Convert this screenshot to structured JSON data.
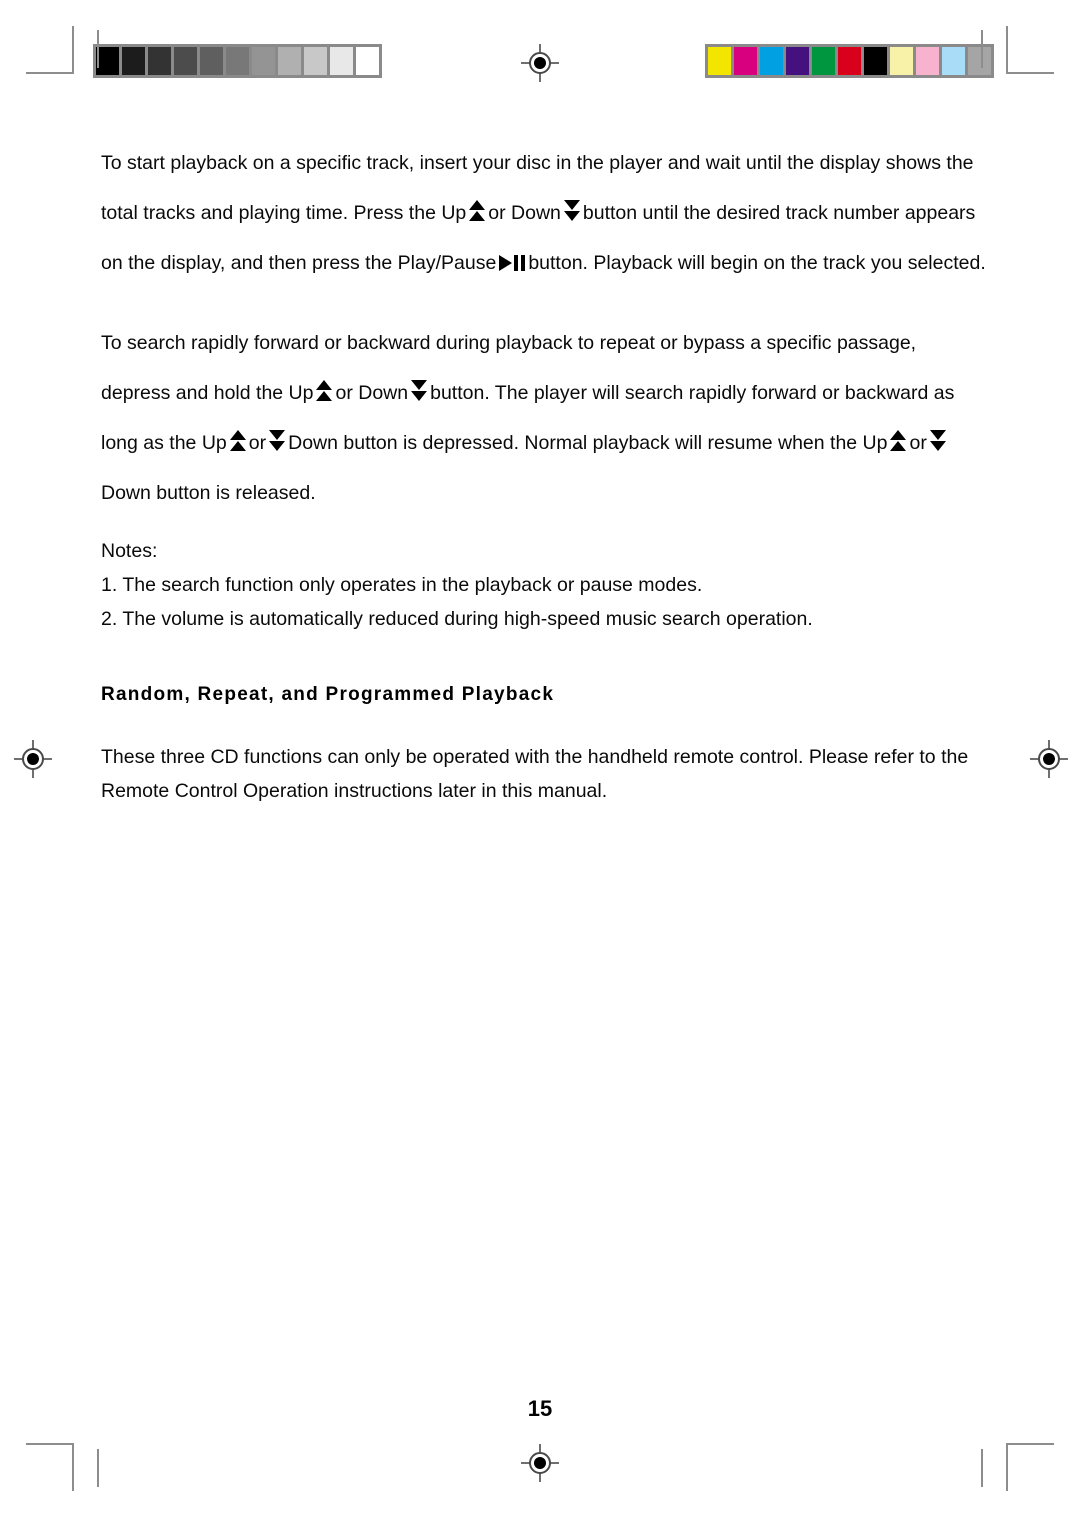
{
  "page": {
    "number": "15"
  },
  "calibration": {
    "grayscale_label": "grayscale-step-wedge",
    "grayscale_swatches": [
      "#000000",
      "#1c1c1c",
      "#333333",
      "#4c4c4c",
      "#5f5f5f",
      "#787878",
      "#949494",
      "#b0b0b0",
      "#c8c8c8",
      "#e8e8e8",
      "#ffffff"
    ],
    "color_label": "color-control-bar",
    "color_swatches": [
      "#f2e500",
      "#d9007f",
      "#00a0e2",
      "#45117e",
      "#009640",
      "#d8001a",
      "#000000",
      "#f7f2a8",
      "#f7b3cd",
      "#a9dcf7",
      "#a5a5a5"
    ]
  },
  "body": {
    "paragraph_1": {
      "segment_1": "To start playback on a specific track, insert your disc in the player and wait until the display shows the total tracks and playing time. Press the Up",
      "segment_2": "or Down",
      "segment_3": "button until the desired track number appears on the display, and then press the Play/Pause",
      "segment_4": "button. Playback will begin on the track you selected."
    },
    "paragraph_2": {
      "segment_1": "To search rapidly forward or backward during playback to repeat or bypass a specific passage, depress and hold the Up",
      "segment_2": "or Down",
      "segment_3": "button. The player will search rapidly forward or backward as long as the Up",
      "segment_4": "or",
      "segment_5": "Down button is depressed. Normal playback will resume when the Up",
      "segment_6": "or",
      "segment_7": "Down button is released."
    },
    "notes_label": "Notes:",
    "notes": [
      "1. The search function only operates in the playback or pause modes.",
      "2. The volume is automatically reduced during high-speed music search operation."
    ],
    "heading": "Random, Repeat, and Programmed Playback",
    "paragraph_3": "These three CD functions can only be operated with the handheld remote control. Please refer to the Remote Control Operation instructions later in this manual."
  }
}
